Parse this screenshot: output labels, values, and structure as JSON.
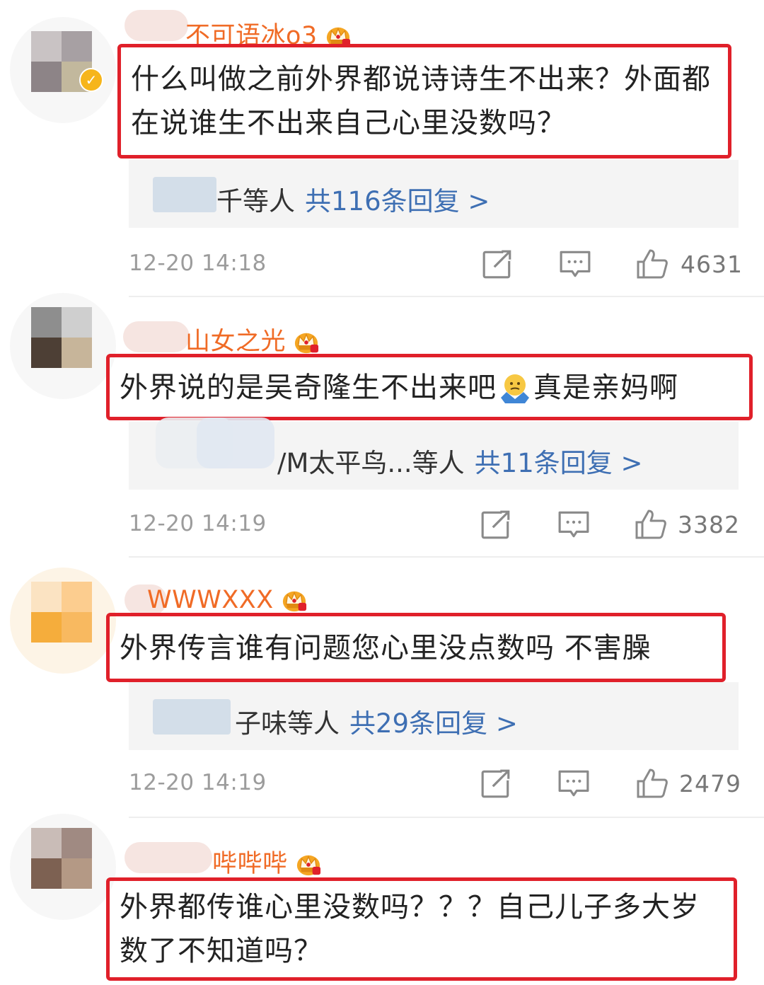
{
  "comments": [
    {
      "username": "不可语冰o3",
      "text": "什么叫做之前外界都说诗诗生不出来？外面都在说谁生不出来自己心里没数吗？",
      "reply_names": "千等人",
      "reply_count": "共116条回复 >",
      "time": "12-20 14:18",
      "likes": "4631",
      "verified": true
    },
    {
      "username": "山女之光",
      "text_before": "外界说的是吴奇隆生不出来吧",
      "text_after": "真是亲妈啊",
      "emoji": "shrug-emoji",
      "reply_names": "/M太平鸟...等人",
      "reply_count": "共11条回复 >",
      "time": "12-20 14:19",
      "likes": "3382"
    },
    {
      "username": "WWWXXX",
      "text": "外界传言谁有问题您心里没点数吗 不害臊",
      "reply_names": "子味等人",
      "reply_count": "共29条回复 >",
      "time": "12-20 14:19",
      "likes": "2479"
    },
    {
      "username": "哔哔哔",
      "text": "外界都传谁心里没数吗？？？自己儿子多大岁数了不知道吗？"
    }
  ],
  "icons": {
    "share": "share-icon",
    "comment": "comment-icon",
    "like": "like-icon",
    "badge": "crown-badge-icon"
  },
  "colors": {
    "username": "#f06b26",
    "highlight_border": "#e0202a",
    "reply_link": "#3e6fb3",
    "meta": "#9c9c9c"
  }
}
